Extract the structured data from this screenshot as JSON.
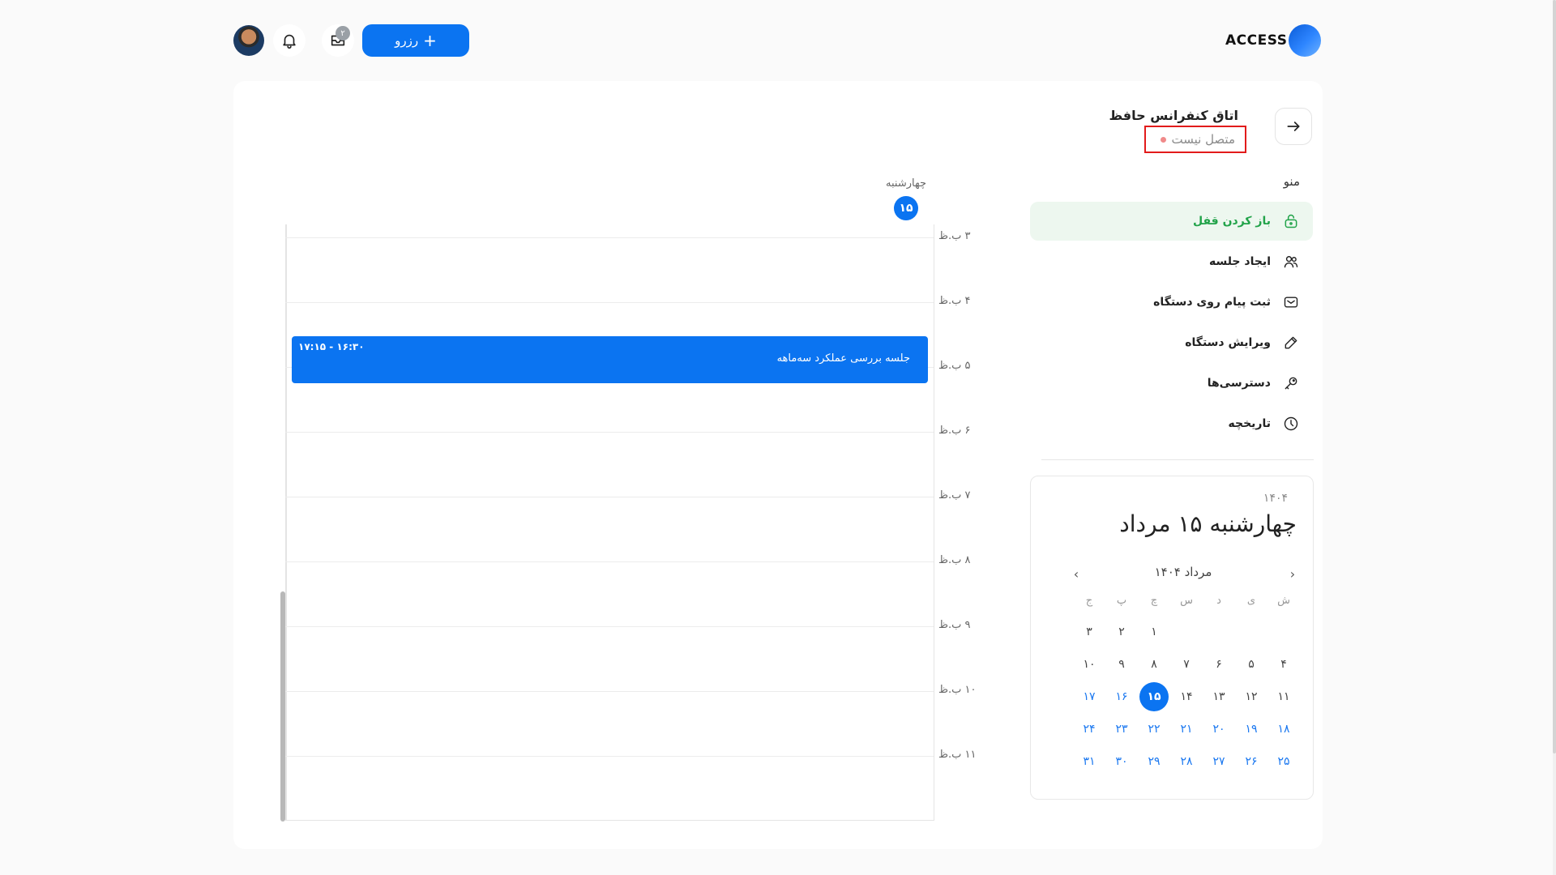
{
  "header": {
    "logo_text": "ACCESS",
    "reserve_label": "رزرو",
    "notification_count": "۲"
  },
  "room": {
    "title": "اتاق کنفرانس حافظ",
    "status": "متصل نیست"
  },
  "menu": {
    "title": "منو",
    "items": [
      {
        "label": "باز کردن قفل",
        "icon": "lock-open-icon",
        "active": true
      },
      {
        "label": "ایجاد جلسه",
        "icon": "users-icon",
        "active": false
      },
      {
        "label": "ثبت پیام روی دستگاه",
        "icon": "envelope-icon",
        "active": false
      },
      {
        "label": "ویرایش دستگاه",
        "icon": "pencil-icon",
        "active": false
      },
      {
        "label": "دسترسی‌ها",
        "icon": "key-icon",
        "active": false
      },
      {
        "label": "تاریخچه",
        "icon": "clock-icon",
        "active": false
      }
    ]
  },
  "calendar": {
    "year": "۱۴۰۴",
    "selected_label": "چهارشنبه ۱۵ مرداد",
    "month_label": "مرداد ۱۴۰۴",
    "weekdays": [
      "ش",
      "ی",
      "د",
      "س",
      "چ",
      "پ",
      "ج"
    ],
    "weeks": [
      [
        "",
        "",
        "",
        "",
        "۱",
        "۲",
        "۳"
      ],
      [
        "۴",
        "۵",
        "۶",
        "۷",
        "۸",
        "۹",
        "۱۰"
      ],
      [
        "۱۱",
        "۱۲",
        "۱۳",
        "۱۴",
        "۱۵",
        "۱۶",
        "۱۷"
      ],
      [
        "۱۸",
        "۱۹",
        "۲۰",
        "۲۱",
        "۲۲",
        "۲۳",
        "۲۴"
      ],
      [
        "۲۵",
        "۲۶",
        "۲۷",
        "۲۸",
        "۲۹",
        "۳۰",
        "۳۱"
      ]
    ],
    "today": "۱۵"
  },
  "schedule": {
    "day_name": "چهارشنبه",
    "day_number": "۱۵",
    "hours": [
      "۳ ب.ظ",
      "۴ ب.ظ",
      "۵ ب.ظ",
      "۶ ب.ظ",
      "۷ ب.ظ",
      "۸ ب.ظ",
      "۹ ب.ظ",
      "۱۰ ب.ظ",
      "۱۱ ب.ظ"
    ],
    "event": {
      "title": "جلسه بررسی عملکرد سه‌ماهه",
      "time": "۱۷:۱۵ - ۱۶:۳۰"
    }
  },
  "colors": {
    "accent": "#0b74f1",
    "active_green": "#22a34a",
    "status_dot": "#f08a8a"
  }
}
